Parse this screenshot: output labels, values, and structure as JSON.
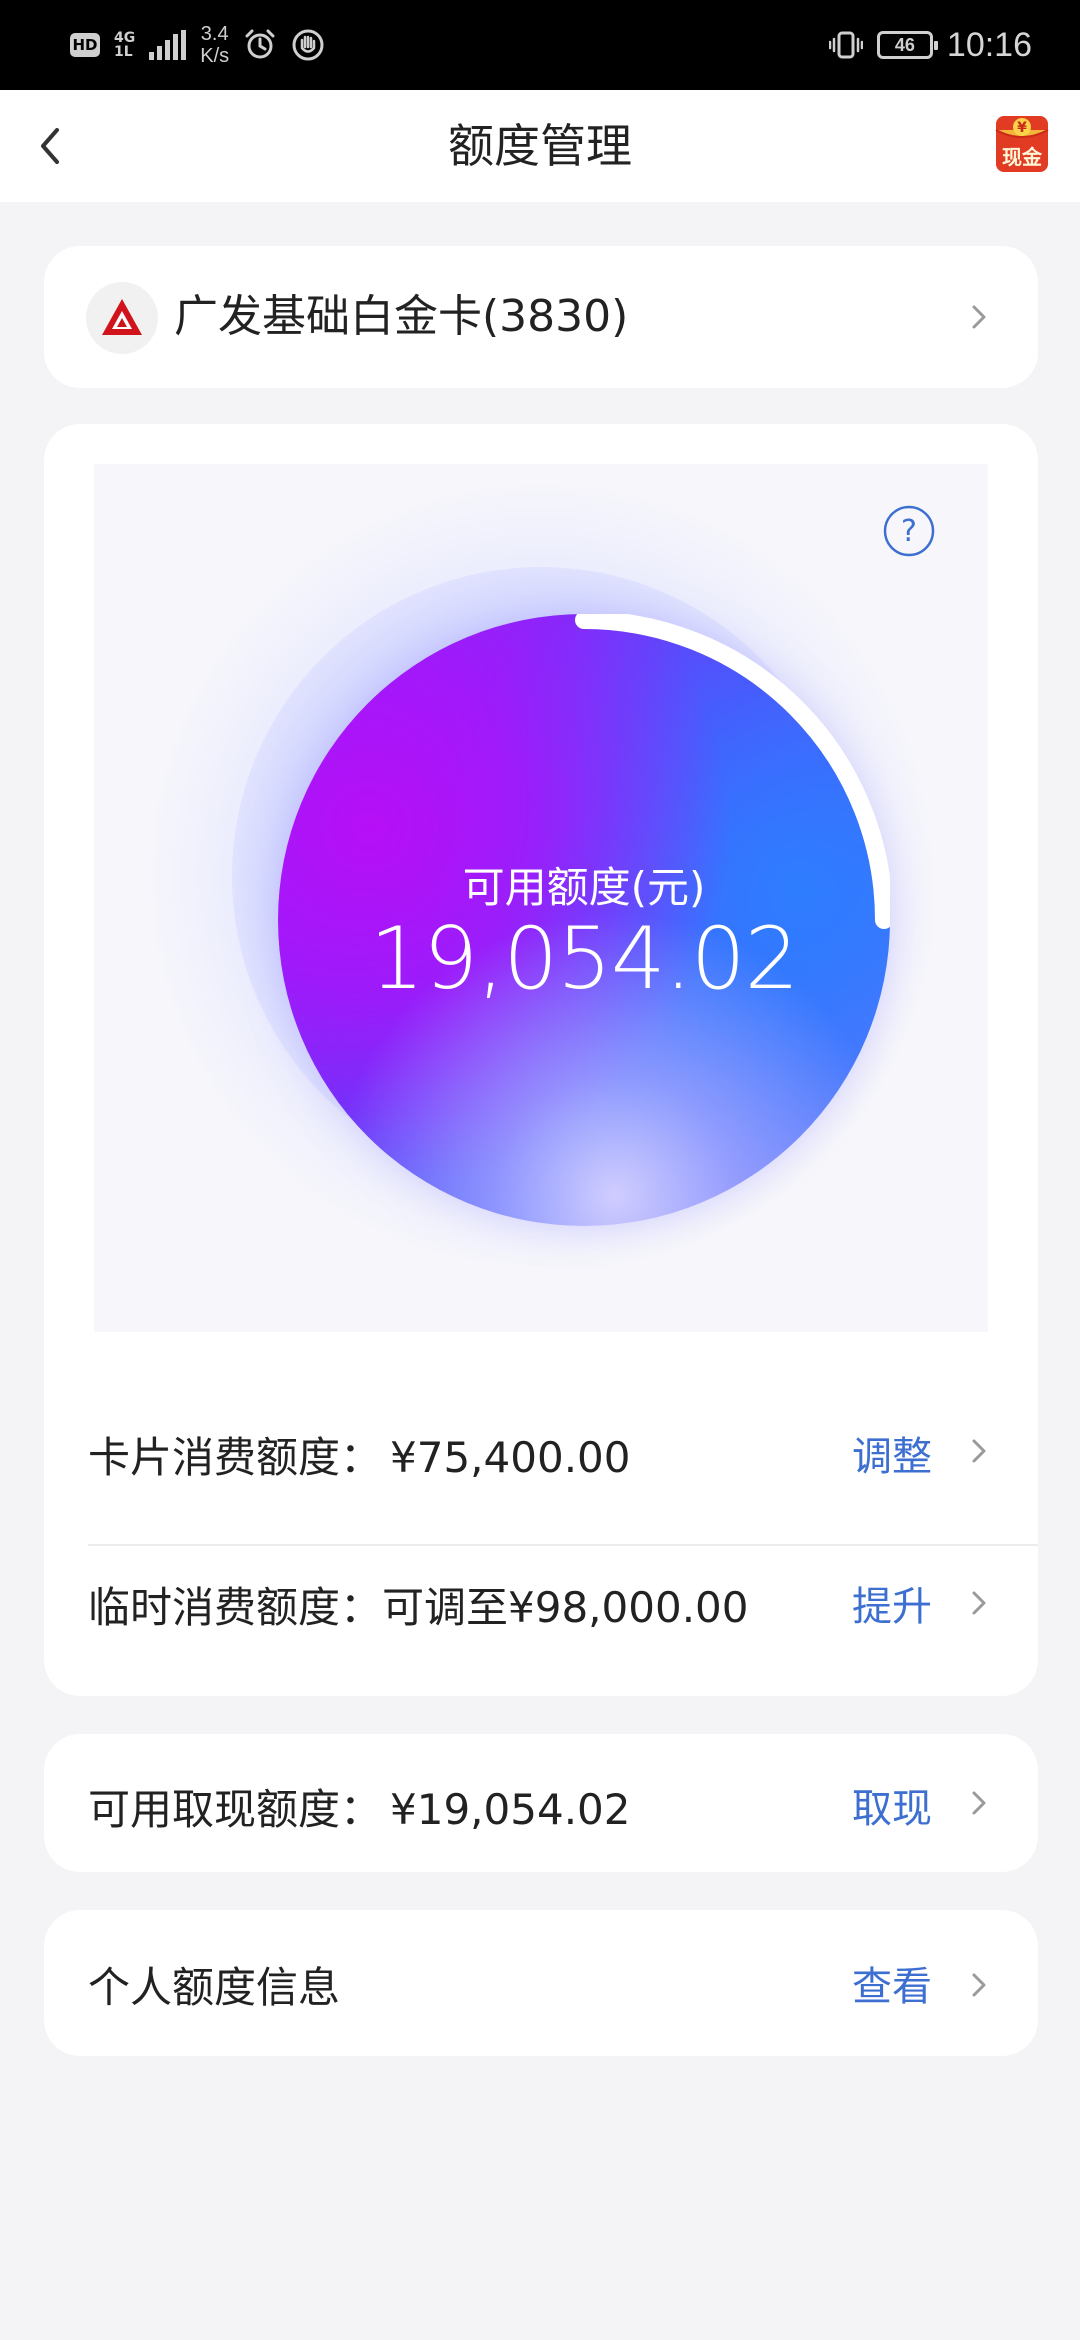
{
  "status_bar": {
    "hd": "HD",
    "network_type_top": "4G",
    "network_type_bottom": "1L",
    "speed_value": "3.4",
    "speed_unit": "K/s",
    "battery": "46",
    "time": "10:16"
  },
  "nav": {
    "title": "额度管理",
    "cash_button_label": "现金",
    "cash_button_symbol": "¥"
  },
  "account": {
    "name": "广发基础白金卡(3830)"
  },
  "credit": {
    "label": "可用额度(元)",
    "value": "19,054.02",
    "used_fraction": 0.25
  },
  "rows": {
    "card_limit": {
      "label": "卡片消费额度：",
      "value": "¥75,400.00",
      "action": "调整"
    },
    "temp_limit": {
      "label": "临时消费额度：",
      "value": "可调至¥98,000.00",
      "action": "提升"
    },
    "cash_limit": {
      "label": "可用取现额度：",
      "value": "¥19,054.02",
      "action": "取现"
    },
    "personal_info": {
      "label": "个人额度信息",
      "action": "查看"
    }
  },
  "colors": {
    "accent": "#3d6fd1",
    "bank_red": "#d1141b",
    "background": "#f4f4f6"
  }
}
